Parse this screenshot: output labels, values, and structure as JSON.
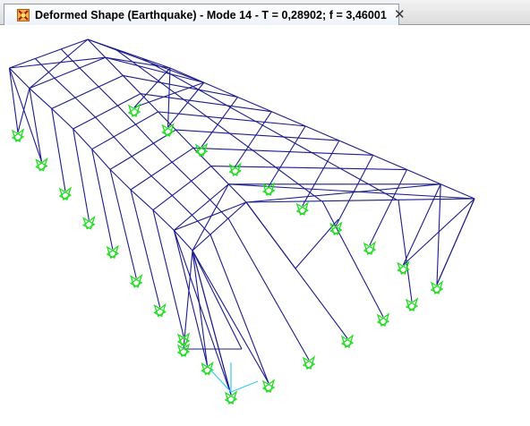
{
  "window": {
    "tab_title": "Deformed Shape (Earthquake) - Mode 14 - T = 0,28902;  f = 3,46001",
    "close_glyph": "✕",
    "app_icon": "structure-app-icon",
    "close_icon": "close-icon"
  },
  "colors": {
    "frame": "#1c1c8c",
    "support": "#22dd22",
    "axis": "#33ccee",
    "tab_bg": "#eef3fa"
  }
}
